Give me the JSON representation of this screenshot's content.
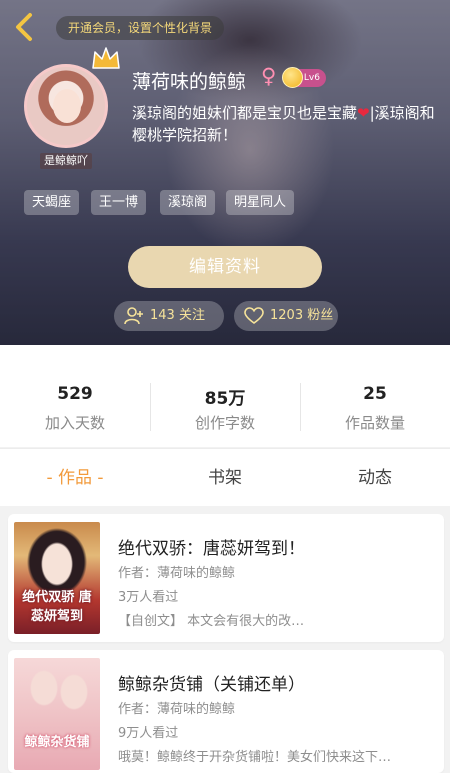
{
  "header": {
    "vip_tip": "开通会员，设置个性化背景",
    "avatar_caption": "是鲸鲸吖",
    "nickname": "薄荷味的鲸鲸",
    "gender_symbol": "♀",
    "level_label": "Lv6",
    "bio_part1": "溪琼阁的姐妹们都是宝贝也是宝藏",
    "bio_heart": "❤",
    "bio_part2": "|溪琼阁和樱桃学院招新！",
    "tags": [
      "天蝎座",
      "王一博",
      "溪琼阁",
      "明星同人"
    ],
    "edit_button": "编辑资料",
    "follow": "143 关注",
    "fans": "1203 粉丝"
  },
  "stats": [
    {
      "value": "529",
      "label": "加入天数"
    },
    {
      "value": "85万",
      "label": "创作字数"
    },
    {
      "value": "25",
      "label": "作品数量"
    }
  ],
  "tabs": [
    {
      "label": "- 作品 -",
      "active": true
    },
    {
      "label": "书架",
      "active": false
    },
    {
      "label": "动态",
      "active": false
    }
  ],
  "works": [
    {
      "cover_text": "绝代双骄 唐蕊妍驾到",
      "title": "绝代双骄：唐蕊妍驾到！",
      "author": "作者：薄荷味的鲸鲸",
      "readers": "3万人看过",
      "description": "【自创文】 本文会有很大的改…"
    },
    {
      "cover_text": "鲸鲸杂货铺",
      "title": "鲸鲸杂货铺（关铺还单）",
      "author": "作者：薄荷味的鲸鲸",
      "readers": "9万人看过",
      "description": "哦莫！鲸鲸终于开杂货铺啦！美女们快来这下…"
    }
  ],
  "colors": {
    "accent_orange": "#f29a3b",
    "gold_text": "#f4d87a",
    "edit_button_bg": "#e9d7b0",
    "level_badge_bg": "#c8518d"
  }
}
